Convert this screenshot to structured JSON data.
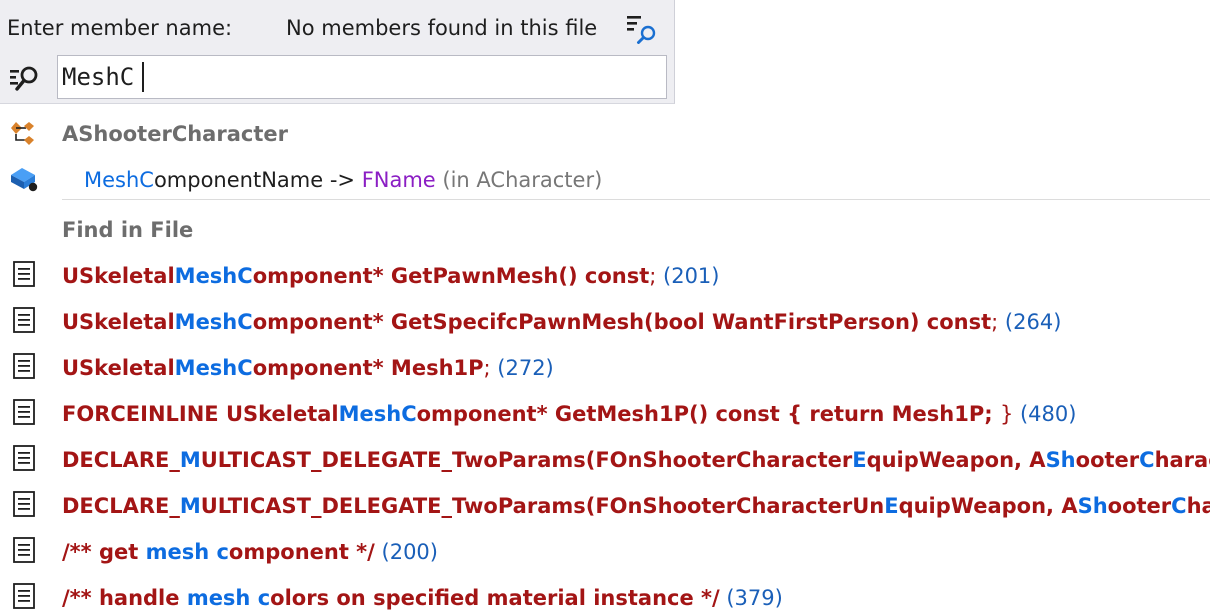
{
  "header": {
    "prompt": "Enter member name:",
    "status": "No members found in this file",
    "filter_icon": "filter-search-icon",
    "search_icon": "search-icon",
    "search_value": "MeshC"
  },
  "colors": {
    "header_bg": "#eeeef2",
    "highlight": "#0d6ce0",
    "code": "#a31515",
    "type": "#8b1ec4",
    "group_label": "#6d6d6d",
    "line_number": "#1a5fb8"
  },
  "results": {
    "class_group": {
      "icon": "class-icon",
      "label": "AShooterCharacter"
    },
    "member": {
      "icon": "field-icon",
      "match": "MeshC",
      "rest": "omponentName -> ",
      "type": "FName",
      "context": " (in ACharacter)"
    },
    "find_group": {
      "label": "Find in File"
    },
    "find_items": [
      {
        "icon": "document-icon",
        "p1": "USkeletal",
        "h1": "MeshC",
        "p2": "omponent* GetPawnMesh() const",
        "tail": ";",
        "line": " (201)"
      },
      {
        "icon": "document-icon",
        "p1": "USkeletal",
        "h1": "MeshC",
        "p2": "omponent* GetSpecifcPawnMesh(bool WantFirstPerson) const",
        "tail": ";",
        "line": " (264)"
      },
      {
        "icon": "document-icon",
        "p1": "USkeletal",
        "h1": "MeshC",
        "p2": "omponent* Mesh1P",
        "tail": ";",
        "line": " (272)"
      },
      {
        "icon": "document-icon",
        "p1": "FORCEINLINE USkeletal",
        "h1": "MeshC",
        "p2": "omponent* GetMesh1P() const { return Mesh1P; ",
        "tail": "}",
        "line": " (480)"
      },
      {
        "icon": "document-icon",
        "p1": "DECLARE_",
        "h1": "M",
        "p2": "ULTICAST_DELEGATE_TwoParams(FOnShooterCharacter",
        "h2": "E",
        "p3": "quipWeapon, A",
        "h3": "Sh",
        "p4": "ooter",
        "h4": "C",
        "p5": "haracter"
      },
      {
        "icon": "document-icon",
        "p1": "DECLARE_",
        "h1": "M",
        "p2": "ULTICAST_DELEGATE_TwoParams(FOnShooterCharacterUn",
        "h2": "E",
        "p3": "quipWeapon, A",
        "h3": "Sh",
        "p4": "ooter",
        "h4": "C",
        "p5": "haracter"
      },
      {
        "icon": "document-icon",
        "p1": "/** get ",
        "h1": "mesh",
        "p2": " ",
        "h2": "c",
        "p3": "omponent */",
        "line": " (200)"
      },
      {
        "icon": "document-icon",
        "p1": "/** handle ",
        "h1": "mesh",
        "p2": " ",
        "h2": "c",
        "p3": "olors on specified material instance */",
        "line": " (379)"
      }
    ]
  }
}
